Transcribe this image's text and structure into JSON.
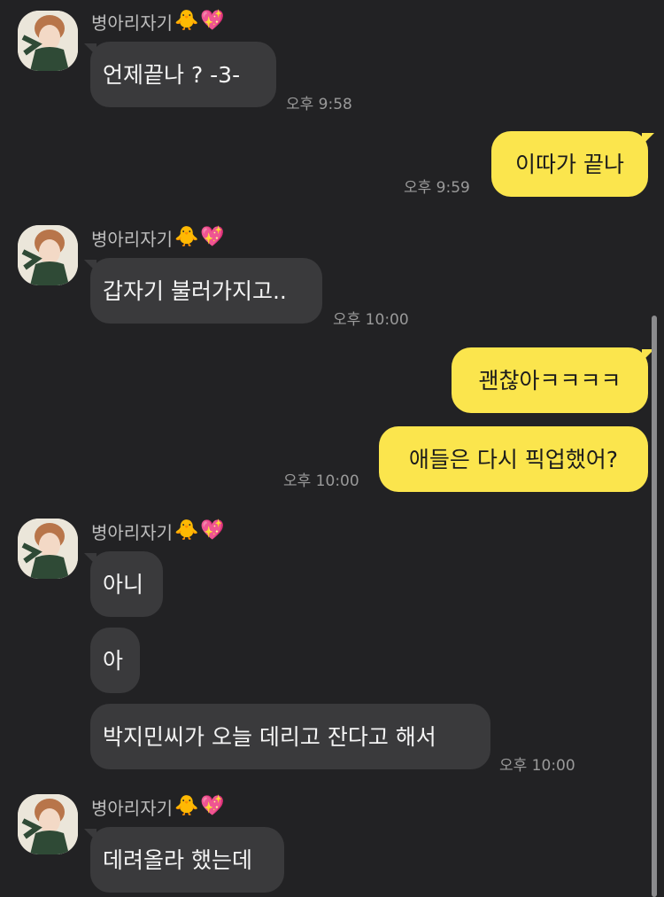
{
  "sender_name": "병아리자기",
  "sender_emoji_chick": "🐥",
  "sender_emoji_heart": "💖",
  "messages": {
    "m1": {
      "text": "언제끝나 ? -3-",
      "time": "오후 9:58"
    },
    "m2": {
      "text": "이따가 끝나",
      "time": "오후 9:59"
    },
    "m3": {
      "text": "갑자기 불러가지고..",
      "time": "오후 10:00"
    },
    "m4": {
      "text": "괜찮아ㅋㅋㅋㅋ"
    },
    "m5": {
      "text": "애들은 다시 픽업했어?",
      "time": "오후 10:00"
    },
    "m6": {
      "text": "아니"
    },
    "m7": {
      "text": "아"
    },
    "m8": {
      "text": "박지민씨가 오늘 데리고 잔다고 해서",
      "time": "오후 10:00"
    },
    "m9": {
      "text": "데려올라 했는데"
    }
  },
  "colors": {
    "background": "#222224",
    "incoming_bubble": "#3a3a3c",
    "outgoing_bubble": "#fbe54d"
  }
}
